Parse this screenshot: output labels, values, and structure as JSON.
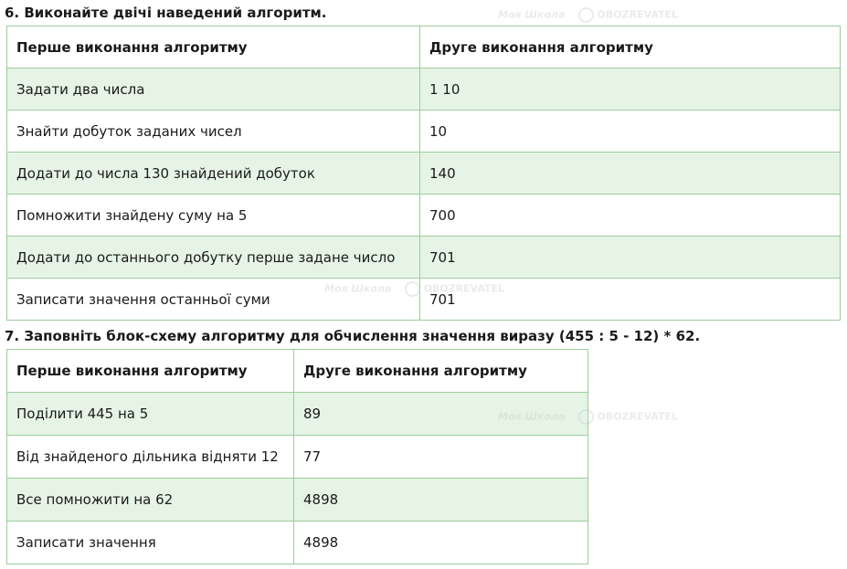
{
  "task6": {
    "title": "6. Виконайте двічі наведений алгоритм.",
    "headers": [
      "Перше виконання алгоритму",
      "Друге виконання алгоритму"
    ],
    "rows": [
      [
        "Задати два числа",
        "1 10"
      ],
      [
        "Знайти добуток заданих чисел",
        "10"
      ],
      [
        "Додати до числа 130 знайдений добуток",
        "140"
      ],
      [
        "Помножити знайдену суму на 5",
        "700"
      ],
      [
        "Додати до останнього добутку перше задане число",
        "701"
      ],
      [
        "Записати значення останньої суми",
        "701"
      ]
    ]
  },
  "task7": {
    "title": "7. Заповніть блок-схему алгоритму для обчислення значення виразу (455 : 5 - 12) * 62.",
    "headers": [
      "Перше виконання алгоритму",
      "Друге виконання алгоритму"
    ],
    "rows": [
      [
        "Поділити 445 на 5",
        "89"
      ],
      [
        "Від знайденого дільника відняти 12",
        "77"
      ],
      [
        "Все помножити на 62",
        "4898"
      ],
      [
        "Записати значення",
        "4898"
      ]
    ]
  },
  "watermark": {
    "brand_a": "Моя Школа",
    "brand_b": "OBOZREVATEL"
  },
  "colors": {
    "row_shade": "#e6f4e6",
    "border": "#9ccc9c"
  }
}
